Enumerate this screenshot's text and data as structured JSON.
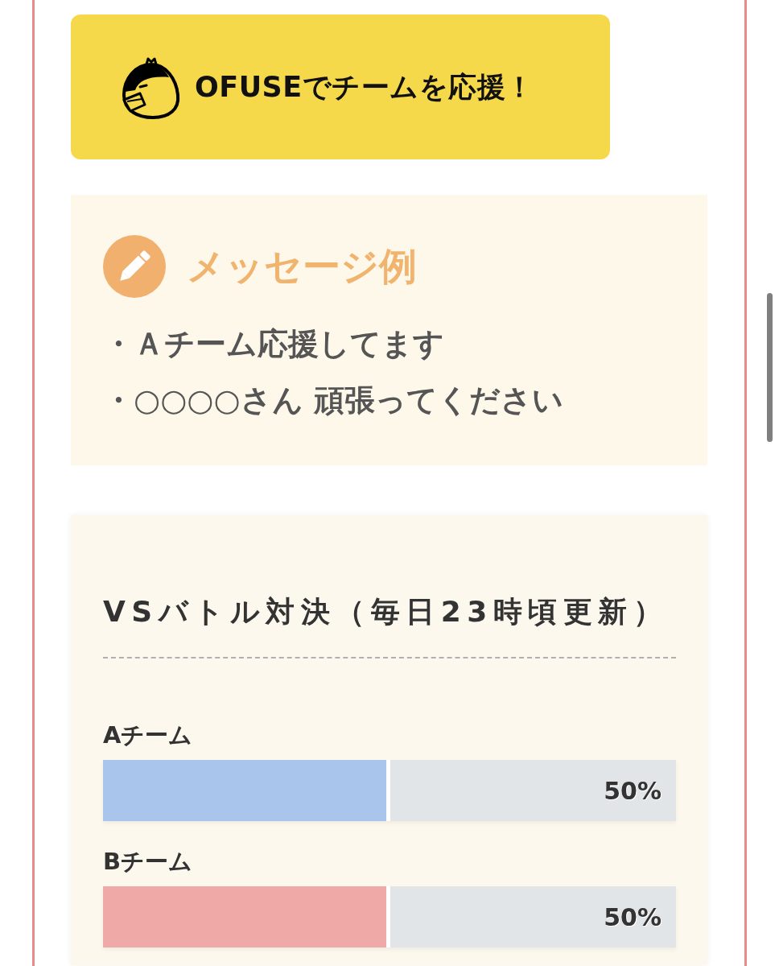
{
  "support_button": {
    "label": "OFUSEでチームを応援！"
  },
  "message_examples": {
    "title": "メッセージ例",
    "items": [
      "・Ａチーム応援してます",
      "・○○○○さん 頑張ってください"
    ]
  },
  "battle": {
    "title": "VSバトル対決（毎日23時頃更新）",
    "teams": [
      {
        "name": "Aチーム",
        "level": 0.5,
        "reading": "50%",
        "color": "#a9c5ec"
      },
      {
        "name": "Bチーム",
        "level": 0.5,
        "reading": "50%",
        "color": "#efaaa8"
      }
    ]
  }
}
